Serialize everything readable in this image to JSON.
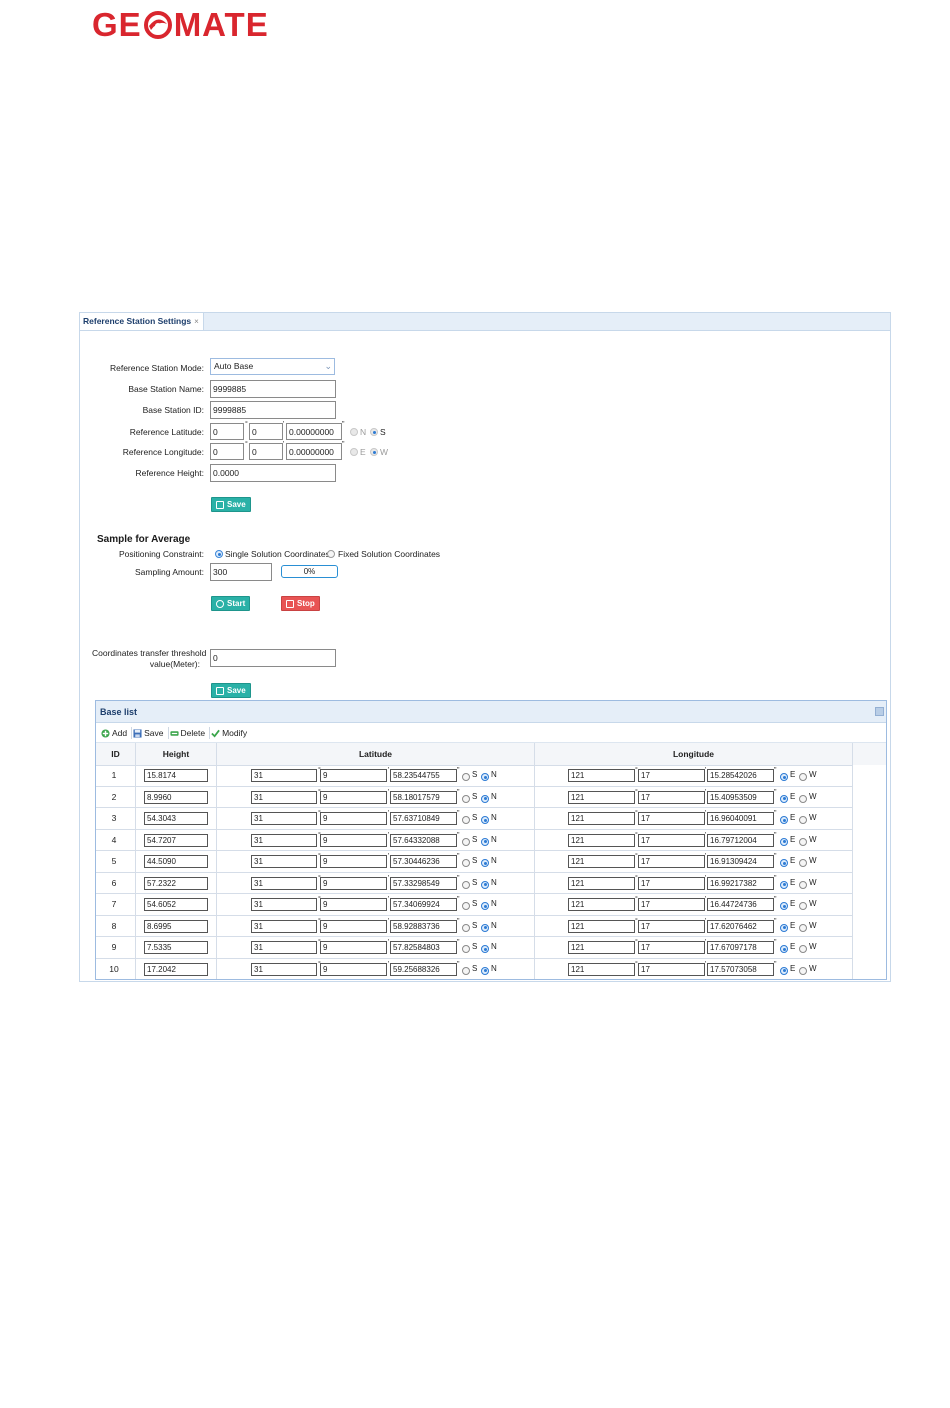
{
  "logo": {
    "text_left": "GE",
    "text_right": "MATE"
  },
  "tab": {
    "title": "Reference Station Settings",
    "close": "×"
  },
  "form": {
    "mode_label": "Reference Station Mode:",
    "mode_value": "Auto Base",
    "name_label": "Base Station Name:",
    "name_value": "9999885",
    "id_label": "Base Station ID:",
    "id_value": "9999885",
    "lat_label": "Reference Latitude:",
    "lat_deg": "0",
    "lat_min": "0",
    "lat_sec": "0.00000000",
    "lat_n": "N",
    "lat_s": "S",
    "lon_label": "Reference Longitude:",
    "lon_deg": "0",
    "lon_min": "0",
    "lon_sec": "0.00000000",
    "lon_e": "E",
    "lon_w": "W",
    "height_label": "Reference Height:",
    "height_value": "0.0000",
    "save_label": "Save"
  },
  "sample": {
    "title": "Sample for Average",
    "constraint_label": "Positioning Constraint:",
    "opt_single": "Single Solution Coordinates",
    "opt_fixed": "Fixed Solution Coordinates",
    "amount_label": "Sampling Amount:",
    "amount_value": "300",
    "progress": "0%",
    "start_label": "Start",
    "stop_label": "Stop"
  },
  "threshold": {
    "label_line1": "Coordinates transfer threshold",
    "label_line2": "value(Meter):",
    "value": "0",
    "save_label": "Save"
  },
  "base_list": {
    "title": "Base list",
    "toolbar": {
      "add": "Add",
      "save": "Save",
      "delete": "Delete",
      "modify": "Modify"
    },
    "columns": {
      "id": "ID",
      "height": "Height",
      "latitude": "Latitude",
      "longitude": "Longitude"
    },
    "ns": {
      "s": "S",
      "n": "N"
    },
    "ew": {
      "e": "E",
      "w": "W"
    },
    "rows": [
      {
        "id": "1",
        "height": "15.8174",
        "lat_d": "31",
        "lat_m": "9",
        "lat_s": "58.23544755",
        "lon_d": "121",
        "lon_m": "17",
        "lon_s": "15.28542026"
      },
      {
        "id": "2",
        "height": "8.9960",
        "lat_d": "31",
        "lat_m": "9",
        "lat_s": "58.18017579",
        "lon_d": "121",
        "lon_m": "17",
        "lon_s": "15.40953509"
      },
      {
        "id": "3",
        "height": "54.3043",
        "lat_d": "31",
        "lat_m": "9",
        "lat_s": "57.63710849",
        "lon_d": "121",
        "lon_m": "17",
        "lon_s": "16.96040091"
      },
      {
        "id": "4",
        "height": "54.7207",
        "lat_d": "31",
        "lat_m": "9",
        "lat_s": "57.64332088",
        "lon_d": "121",
        "lon_m": "17",
        "lon_s": "16.79712004"
      },
      {
        "id": "5",
        "height": "44.5090",
        "lat_d": "31",
        "lat_m": "9",
        "lat_s": "57.30446236",
        "lon_d": "121",
        "lon_m": "17",
        "lon_s": "16.91309424"
      },
      {
        "id": "6",
        "height": "57.2322",
        "lat_d": "31",
        "lat_m": "9",
        "lat_s": "57.33298549",
        "lon_d": "121",
        "lon_m": "17",
        "lon_s": "16.99217382"
      },
      {
        "id": "7",
        "height": "54.6052",
        "lat_d": "31",
        "lat_m": "9",
        "lat_s": "57.34069924",
        "lon_d": "121",
        "lon_m": "17",
        "lon_s": "16.44724736"
      },
      {
        "id": "8",
        "height": "8.6995",
        "lat_d": "31",
        "lat_m": "9",
        "lat_s": "58.92883736",
        "lon_d": "121",
        "lon_m": "17",
        "lon_s": "17.62076462"
      },
      {
        "id": "9",
        "height": "7.5335",
        "lat_d": "31",
        "lat_m": "9",
        "lat_s": "57.82584803",
        "lon_d": "121",
        "lon_m": "17",
        "lon_s": "17.67097178"
      },
      {
        "id": "10",
        "height": "17.2042",
        "lat_d": "31",
        "lat_m": "9",
        "lat_s": "59.25688326",
        "lon_d": "121",
        "lon_m": "17",
        "lon_s": "17.57073058"
      }
    ]
  },
  "colors": {
    "brand": "#d9262e",
    "teal": "#2ab1a7",
    "red": "#e85454",
    "header_bg": "#e5eef8"
  },
  "icons": {
    "save": "floppy-icon",
    "start": "play-circle-icon",
    "stop": "stop-icon",
    "add": "plus-circle-icon",
    "delete": "minus-icon",
    "modify": "check-icon"
  }
}
